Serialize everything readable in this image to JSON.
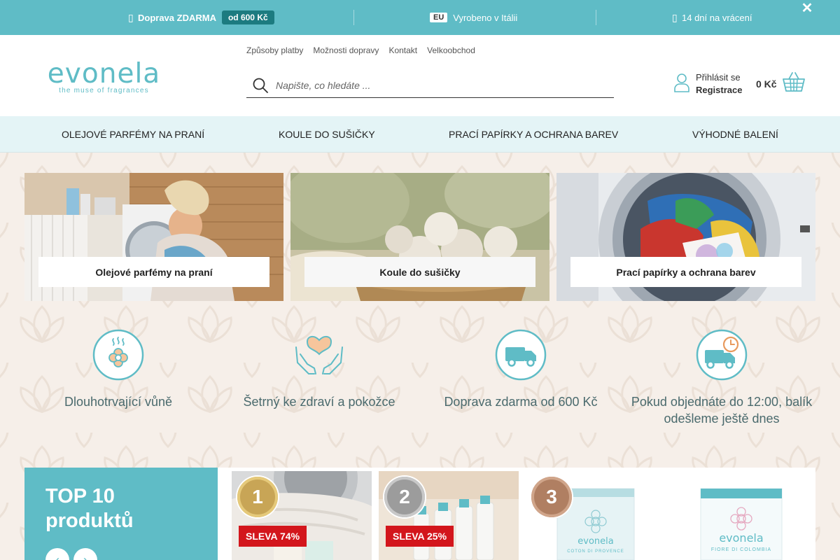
{
  "topbar": {
    "free_shipping_label": "Doprava ZDARMA",
    "free_shipping_tag": "od 600 Kč",
    "eu_tag": "EU",
    "made_in": "Vyrobeno v Itálii",
    "returns": "14 dní na vrácení",
    "close_glyph": "✕"
  },
  "header": {
    "logo_word": "evonela",
    "logo_tagline": "the muse of fragrances",
    "links": [
      "Způsoby platby",
      "Možnosti dopravy",
      "Kontakt",
      "Velkoobchod"
    ],
    "search_placeholder": "Napište, co hledáte ...",
    "login_label": "Přihlásit se",
    "register_label": "Registrace",
    "cart_total": "0 Kč"
  },
  "nav": {
    "items": [
      "OLEJOVÉ PARFÉMY NA PRANÍ",
      "KOULE DO SUŠIČKY",
      "PRACÍ PAPÍRKY A OCHRANA BAREV",
      "VÝHODNÉ BALENÍ"
    ]
  },
  "categories": [
    {
      "label": "Olejové parfémy na praní"
    },
    {
      "label": "Koule do sušičky"
    },
    {
      "label": "Prací papírky a ochrana barev"
    }
  ],
  "features": [
    {
      "text": "Dlouhotrvající vůně",
      "icon": "flower-scent-icon"
    },
    {
      "text": "Šetrný ke zdraví a pokožce",
      "icon": "heart-hands-icon"
    },
    {
      "text": "Doprava zdarma od 600 Kč",
      "icon": "delivery-truck-icon"
    },
    {
      "text": "Pokud objednáte do 12:00, balík odešleme ještě dnes",
      "icon": "truck-clock-icon"
    }
  ],
  "top10": {
    "title_line1": "TOP 10",
    "title_line2": "produktů",
    "prev_glyph": "‹",
    "next_glyph": "›"
  },
  "products": [
    {
      "rank": "1",
      "sale": "SLEVA 74%"
    },
    {
      "rank": "2",
      "sale": "SLEVA 25%"
    },
    {
      "rank": "3",
      "pack_brand": "evonela",
      "pack_name": "COTON DI PROVENCE"
    },
    {
      "pack_brand": "evonela",
      "pack_name": "FIORE DI COLOMBIA"
    }
  ],
  "colors": {
    "accent": "#5fbcc6",
    "accent_dark": "#1c7b80",
    "sale_red": "#d3161c",
    "nav_bg": "#e4f4f6",
    "page_bg": "#f6efe9"
  }
}
